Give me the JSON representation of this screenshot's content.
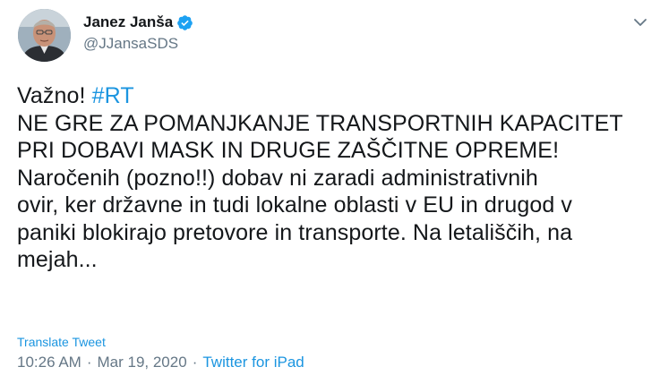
{
  "author": {
    "name": "Janez Janša",
    "handle": "@JJansaSDS",
    "verified": true,
    "avatar_icon": "profile-photo"
  },
  "tweet": {
    "intro": "Važno! ",
    "hashtag": "#RT",
    "lines": [
      "NE GRE ZA POMANJKANJE TRANSPORTNIH KAPACITET",
      "PRI DOBAVI MASK IN DRUGE ZAŠČITNE OPREME!",
      "Naročenih (pozno!!) dobav ni zaradi administrativnih",
      "ovir, ker državne in tudi lokalne oblasti v EU in drugod v",
      "paniki blokirajo pretovore in transporte. Na letališčih, na",
      "mejah..."
    ]
  },
  "translate_label": "Translate Tweet",
  "meta": {
    "time": "10:26 AM",
    "separator": "·",
    "date": "Mar 19, 2020",
    "source": "Twitter for iPad"
  },
  "colors": {
    "link": "#1b95e0",
    "text": "#14171a",
    "secondary": "#657786",
    "verified": "#1da1f2"
  }
}
